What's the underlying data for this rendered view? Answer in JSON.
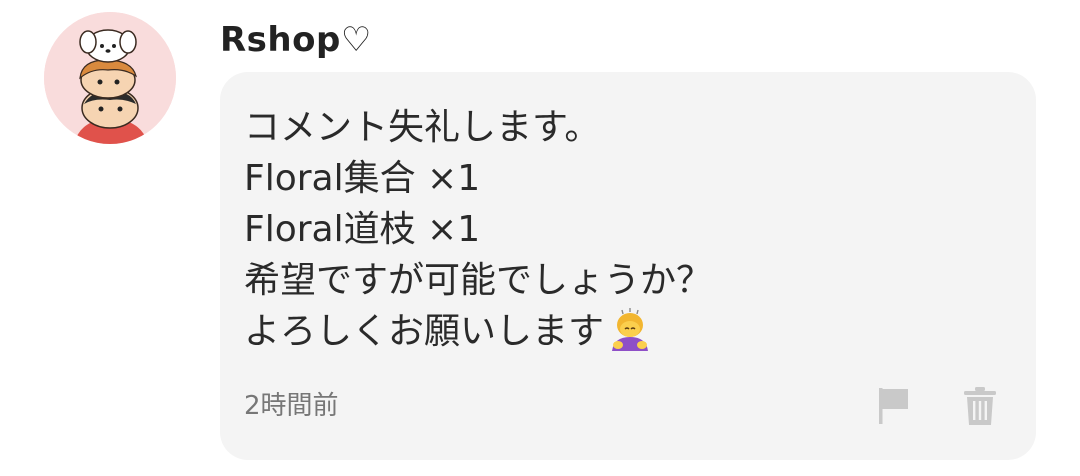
{
  "comment": {
    "avatar_icon": "character-stack-avatar",
    "username": "Rshop♡",
    "message_lines": [
      "コメント失礼します。",
      "Floral集合 ×1",
      "Floral道枝 ×1",
      "希望ですが可能でしょうか？",
      "よろしくお願いします"
    ],
    "message_emoji": "person-bowing-emoji",
    "timestamp": "2時間前",
    "actions": {
      "report_icon": "flag-icon",
      "delete_icon": "trash-icon"
    }
  },
  "colors": {
    "bubble_background": "#f4f4f4",
    "avatar_background": "#f9dcdc",
    "text": "#2a2a2a",
    "muted": "#777777",
    "icon_gray": "#c9c9c9"
  }
}
